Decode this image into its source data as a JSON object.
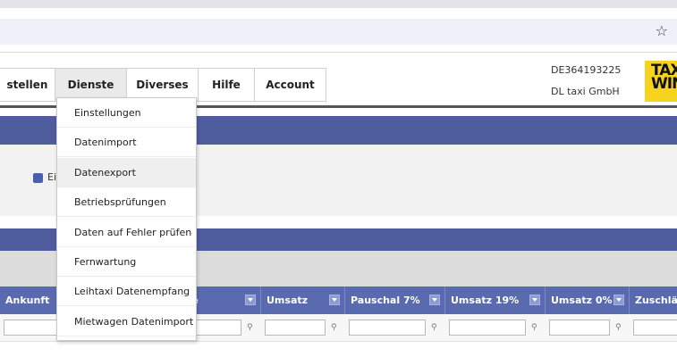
{
  "browser": {
    "star_icon": "☆"
  },
  "menu": {
    "items": [
      {
        "label": "stellen",
        "width": 62
      },
      {
        "label": "Dienste",
        "width": 80,
        "active": true
      },
      {
        "label": "Diverses",
        "width": 80
      },
      {
        "label": "Hilfe",
        "width": 63
      },
      {
        "label": "Account",
        "width": 80
      }
    ]
  },
  "company": {
    "vat_id": "DE364193225",
    "name": "DL taxi GmbH"
  },
  "logo": {
    "line1": "TAX",
    "line2": "WIN"
  },
  "checkbox_label": "Ei",
  "dropdown": {
    "items": [
      "Einstellungen",
      "Datenimport",
      "Datenexport",
      "Betriebsprüfungen",
      "Daten auf Fehler prüfen",
      "Fernwartung",
      "Leihtaxi Datenempfang",
      "Mietwagen Datenimport"
    ],
    "hovered_index": 2
  },
  "table": {
    "columns": [
      {
        "label": "Ankunft"
      },
      {
        "label": ""
      },
      {
        "label": "ise"
      },
      {
        "label": "Umsatz"
      },
      {
        "label": "Pauschal 7%"
      },
      {
        "label": "Umsatz 19%"
      },
      {
        "label": "Umsatz 0%"
      },
      {
        "label": "Zuschläge"
      }
    ]
  }
}
